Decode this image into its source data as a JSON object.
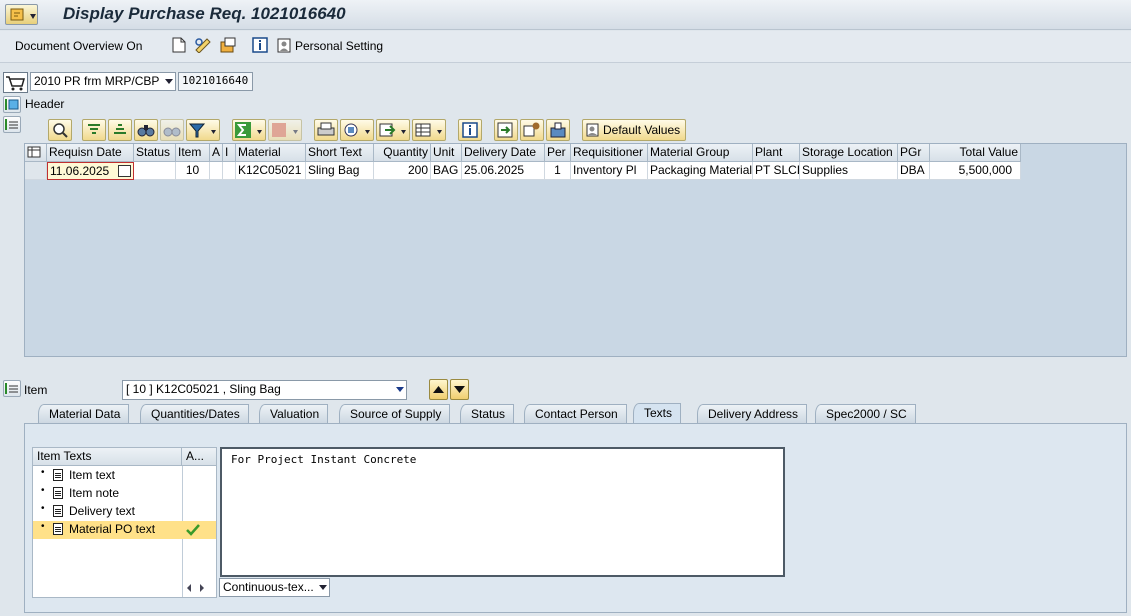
{
  "window": {
    "title": "Display Purchase Req. 1021016640"
  },
  "toolbar": {
    "doc_overview_label": "Document Overview On",
    "personal_setting_label": "Personal Setting"
  },
  "header_area": {
    "doc_type_value": "2010 PR frm MRP/CBP",
    "pr_number": "1021016640",
    "header_label": "Header"
  },
  "grid_toolbar": {
    "default_values_label": "Default Values"
  },
  "items_table": {
    "columns": [
      "Requisn Date",
      "Status",
      "Item",
      "A",
      "I",
      "Material",
      "Short Text",
      "Quantity",
      "Unit",
      "Delivery Date",
      "Per",
      "Requisitioner",
      "Material Group",
      "Plant",
      "Storage Location",
      "PGr",
      "Total Value"
    ],
    "rows": [
      [
        "11.06.2025",
        "",
        "10",
        "",
        "",
        "K12C05021",
        "Sling Bag",
        "200",
        "BAG",
        "25.06.2025",
        "1",
        "Inventory Pl",
        "Packaging Material",
        "PT SLCI",
        "Supplies",
        "DBA",
        "5,500,000"
      ]
    ]
  },
  "item_section": {
    "label": "Item",
    "selected_item": "[ 10 ] K12C05021 , Sling Bag"
  },
  "tabs": [
    "Material Data",
    "Quantities/Dates",
    "Valuation",
    "Source of Supply",
    "Status",
    "Contact Person",
    "Texts",
    "Delivery Address",
    "Spec2000 / SC"
  ],
  "active_tab": "Texts",
  "texts_tree": {
    "col_item_texts": "Item Texts",
    "col_a": "A...",
    "items": [
      {
        "label": "Item text",
        "selected": false,
        "checked": false
      },
      {
        "label": "Item note",
        "selected": false,
        "checked": false
      },
      {
        "label": "Delivery text",
        "selected": false,
        "checked": false
      },
      {
        "label": "Material PO text",
        "selected": true,
        "checked": true
      }
    ]
  },
  "editor": {
    "text": "For Project Instant Concrete",
    "format_select": "Continuous-tex..."
  }
}
